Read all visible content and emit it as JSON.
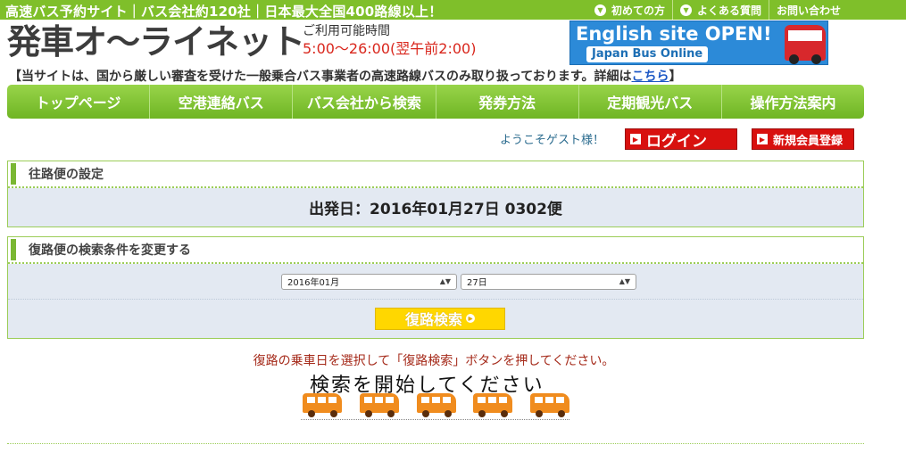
{
  "top": {
    "tagline": "高速バス予約サイト｜バス会社約120社｜日本最大全国400路線以上！",
    "links": [
      {
        "label": "初めての方",
        "icon": "chevron-down-circle-icon"
      },
      {
        "label": "よくある質問",
        "icon": "chevron-down-circle-icon"
      },
      {
        "label": "お問い合わせ"
      }
    ]
  },
  "header": {
    "logo": "発車オ～ライネット",
    "hours_label": "ご利用可能時間",
    "hours_value": "5:00〜26:00(翌午前2:00)",
    "banner_title": "English site OPEN!",
    "banner_sub": "Japan Bus Online"
  },
  "notice": {
    "text": "【当サイトは、国から厳しい審査を受けた一般乗合バス事業者の高速路線バスのみ取り扱っております。詳細は",
    "link": "こちら",
    "end": "】"
  },
  "nav": [
    {
      "label": "トップページ"
    },
    {
      "label": "空港連絡バス"
    },
    {
      "label": "バス会社から検索"
    },
    {
      "label": "発券方法"
    },
    {
      "label": "定期観光バス"
    },
    {
      "label": "操作方法案内"
    }
  ],
  "account": {
    "welcome": "ようこそゲスト様！",
    "login": "ログイン",
    "register": "新規会員登録"
  },
  "outbound": {
    "title": "往路便の設定",
    "summary": "出発日：2016年01月27日 0302便"
  },
  "return": {
    "title": "復路便の検索条件を変更する",
    "month_value": "2016年01月",
    "day_value": "27日",
    "search_button": "復路検索"
  },
  "instruction": "復路の乗車日を選択して「復路検索」ボタンを押してください。",
  "loading": {
    "text": "検索を開始してください",
    "bus_color": "#f08c1e"
  },
  "colors": {
    "accent_green": "#7fbf2a",
    "alert_red": "#d8110f",
    "search_yellow": "#ffd700"
  }
}
